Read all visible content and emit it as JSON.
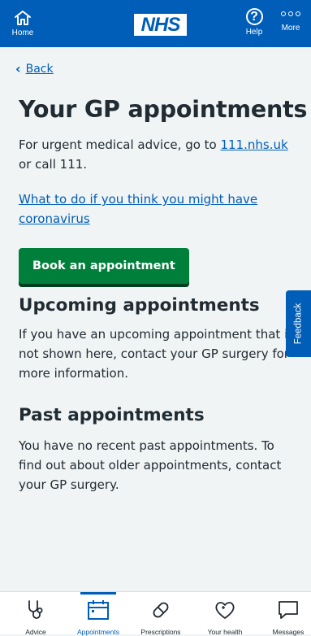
{
  "header": {
    "home_label": "Home",
    "logo_text": "NHS",
    "help_label": "Help",
    "more_label": "More"
  },
  "back": {
    "label": "Back"
  },
  "main": {
    "title": "Your GP appointments",
    "urgent_prefix": "For urgent medical advice, go to ",
    "urgent_link": "111.nhs.uk",
    "urgent_suffix": " or call 111.",
    "coronavirus_link": "What to do if you think you might have coronavirus",
    "book_button": "Book an appointment",
    "upcoming_heading": "Upcoming appointments",
    "upcoming_text": "If you have an upcoming appointment that is not shown here, contact your GP surgery for more information.",
    "past_heading": "Past appointments",
    "past_text": "You have no recent past appointments. To find out about older appointments, contact your GP surgery."
  },
  "feedback": {
    "label": "Feedback"
  },
  "nav": {
    "items": [
      {
        "label": "Advice",
        "icon": "stethoscope-icon"
      },
      {
        "label": "Appointments",
        "icon": "calendar-icon"
      },
      {
        "label": "Prescriptions",
        "icon": "pill-icon"
      },
      {
        "label": "Your health",
        "icon": "heart-icon"
      },
      {
        "label": "Messages",
        "icon": "message-icon"
      }
    ],
    "active_index": 1
  },
  "colors": {
    "nhs_blue": "#005eb8",
    "green": "#007f3b",
    "background": "#f0f4f5",
    "text": "#212b32"
  }
}
